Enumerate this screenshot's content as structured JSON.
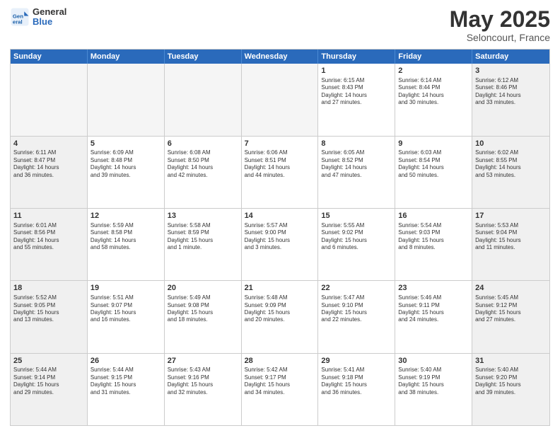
{
  "header": {
    "logo_general": "General",
    "logo_blue": "Blue",
    "month": "May 2025",
    "location": "Seloncourt, France"
  },
  "days": [
    "Sunday",
    "Monday",
    "Tuesday",
    "Wednesday",
    "Thursday",
    "Friday",
    "Saturday"
  ],
  "weeks": [
    [
      {
        "day": "",
        "text": ""
      },
      {
        "day": "",
        "text": ""
      },
      {
        "day": "",
        "text": ""
      },
      {
        "day": "",
        "text": ""
      },
      {
        "day": "1",
        "text": "Sunrise: 6:15 AM\nSunset: 8:43 PM\nDaylight: 14 hours\nand 27 minutes."
      },
      {
        "day": "2",
        "text": "Sunrise: 6:14 AM\nSunset: 8:44 PM\nDaylight: 14 hours\nand 30 minutes."
      },
      {
        "day": "3",
        "text": "Sunrise: 6:12 AM\nSunset: 8:46 PM\nDaylight: 14 hours\nand 33 minutes."
      }
    ],
    [
      {
        "day": "4",
        "text": "Sunrise: 6:11 AM\nSunset: 8:47 PM\nDaylight: 14 hours\nand 36 minutes."
      },
      {
        "day": "5",
        "text": "Sunrise: 6:09 AM\nSunset: 8:48 PM\nDaylight: 14 hours\nand 39 minutes."
      },
      {
        "day": "6",
        "text": "Sunrise: 6:08 AM\nSunset: 8:50 PM\nDaylight: 14 hours\nand 42 minutes."
      },
      {
        "day": "7",
        "text": "Sunrise: 6:06 AM\nSunset: 8:51 PM\nDaylight: 14 hours\nand 44 minutes."
      },
      {
        "day": "8",
        "text": "Sunrise: 6:05 AM\nSunset: 8:52 PM\nDaylight: 14 hours\nand 47 minutes."
      },
      {
        "day": "9",
        "text": "Sunrise: 6:03 AM\nSunset: 8:54 PM\nDaylight: 14 hours\nand 50 minutes."
      },
      {
        "day": "10",
        "text": "Sunrise: 6:02 AM\nSunset: 8:55 PM\nDaylight: 14 hours\nand 53 minutes."
      }
    ],
    [
      {
        "day": "11",
        "text": "Sunrise: 6:01 AM\nSunset: 8:56 PM\nDaylight: 14 hours\nand 55 minutes."
      },
      {
        "day": "12",
        "text": "Sunrise: 5:59 AM\nSunset: 8:58 PM\nDaylight: 14 hours\nand 58 minutes."
      },
      {
        "day": "13",
        "text": "Sunrise: 5:58 AM\nSunset: 8:59 PM\nDaylight: 15 hours\nand 1 minute."
      },
      {
        "day": "14",
        "text": "Sunrise: 5:57 AM\nSunset: 9:00 PM\nDaylight: 15 hours\nand 3 minutes."
      },
      {
        "day": "15",
        "text": "Sunrise: 5:55 AM\nSunset: 9:02 PM\nDaylight: 15 hours\nand 6 minutes."
      },
      {
        "day": "16",
        "text": "Sunrise: 5:54 AM\nSunset: 9:03 PM\nDaylight: 15 hours\nand 8 minutes."
      },
      {
        "day": "17",
        "text": "Sunrise: 5:53 AM\nSunset: 9:04 PM\nDaylight: 15 hours\nand 11 minutes."
      }
    ],
    [
      {
        "day": "18",
        "text": "Sunrise: 5:52 AM\nSunset: 9:05 PM\nDaylight: 15 hours\nand 13 minutes."
      },
      {
        "day": "19",
        "text": "Sunrise: 5:51 AM\nSunset: 9:07 PM\nDaylight: 15 hours\nand 16 minutes."
      },
      {
        "day": "20",
        "text": "Sunrise: 5:49 AM\nSunset: 9:08 PM\nDaylight: 15 hours\nand 18 minutes."
      },
      {
        "day": "21",
        "text": "Sunrise: 5:48 AM\nSunset: 9:09 PM\nDaylight: 15 hours\nand 20 minutes."
      },
      {
        "day": "22",
        "text": "Sunrise: 5:47 AM\nSunset: 9:10 PM\nDaylight: 15 hours\nand 22 minutes."
      },
      {
        "day": "23",
        "text": "Sunrise: 5:46 AM\nSunset: 9:11 PM\nDaylight: 15 hours\nand 24 minutes."
      },
      {
        "day": "24",
        "text": "Sunrise: 5:45 AM\nSunset: 9:12 PM\nDaylight: 15 hours\nand 27 minutes."
      }
    ],
    [
      {
        "day": "25",
        "text": "Sunrise: 5:44 AM\nSunset: 9:14 PM\nDaylight: 15 hours\nand 29 minutes."
      },
      {
        "day": "26",
        "text": "Sunrise: 5:44 AM\nSunset: 9:15 PM\nDaylight: 15 hours\nand 31 minutes."
      },
      {
        "day": "27",
        "text": "Sunrise: 5:43 AM\nSunset: 9:16 PM\nDaylight: 15 hours\nand 32 minutes."
      },
      {
        "day": "28",
        "text": "Sunrise: 5:42 AM\nSunset: 9:17 PM\nDaylight: 15 hours\nand 34 minutes."
      },
      {
        "day": "29",
        "text": "Sunrise: 5:41 AM\nSunset: 9:18 PM\nDaylight: 15 hours\nand 36 minutes."
      },
      {
        "day": "30",
        "text": "Sunrise: 5:40 AM\nSunset: 9:19 PM\nDaylight: 15 hours\nand 38 minutes."
      },
      {
        "day": "31",
        "text": "Sunrise: 5:40 AM\nSunset: 9:20 PM\nDaylight: 15 hours\nand 39 minutes."
      }
    ]
  ]
}
